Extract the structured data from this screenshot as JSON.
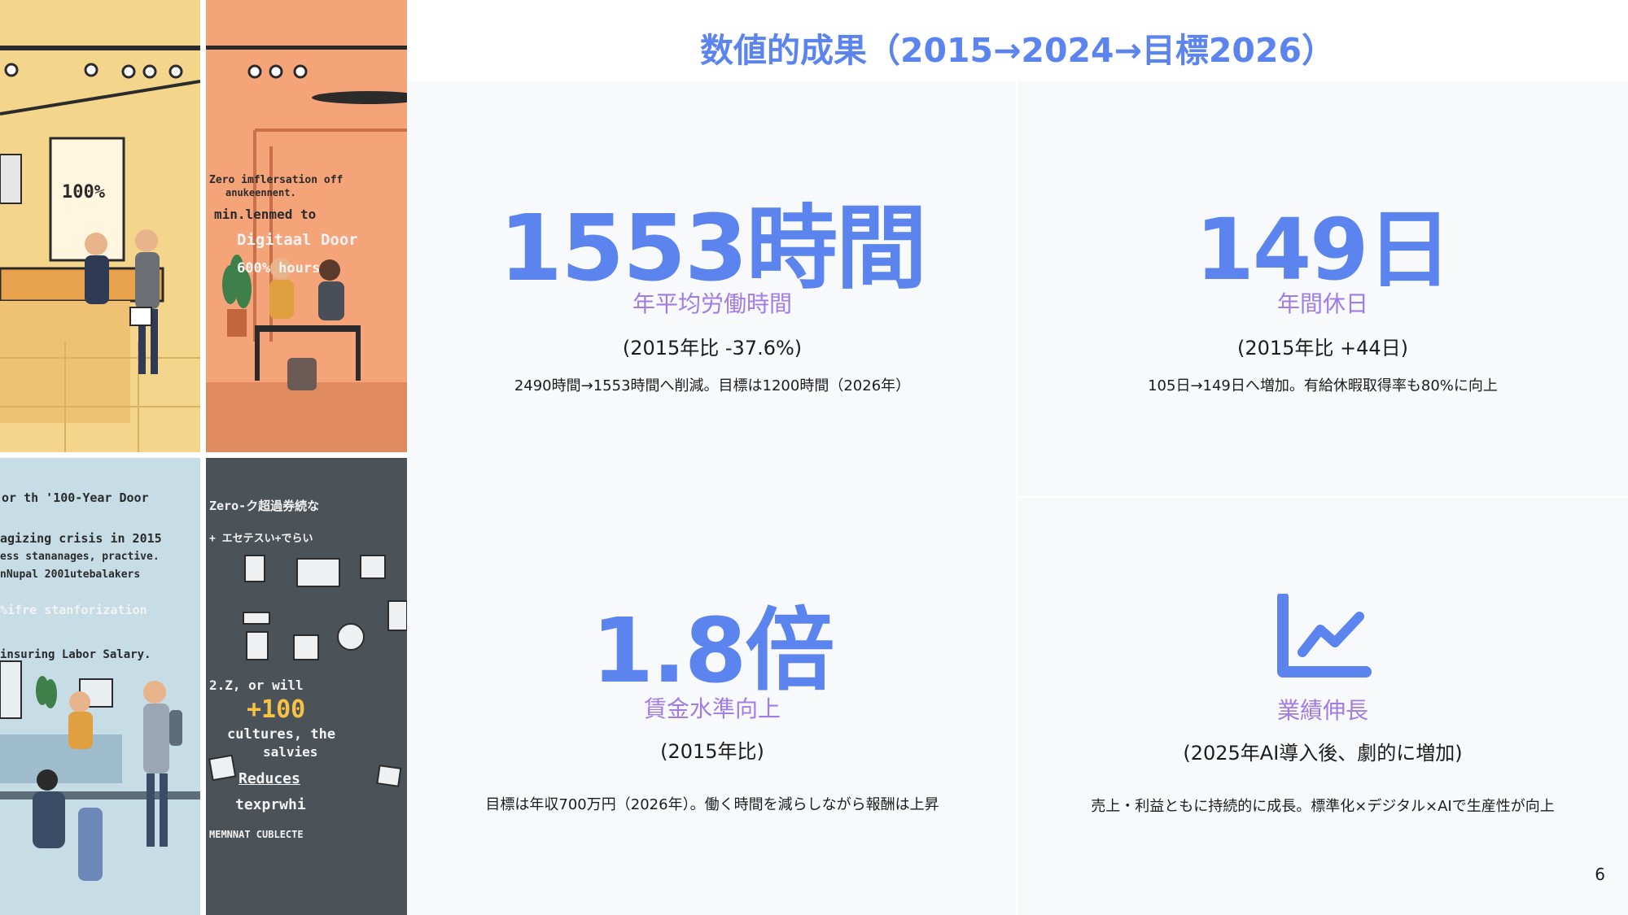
{
  "title": "数値的成果（2015→2024→目標2026）",
  "metrics": [
    {
      "value": "1553時間",
      "label": "年平均労働時間",
      "sub": "(2015年比 -37.6%)",
      "desc": "2490時間→1553時間へ削減。目標は1200時間（2026年）"
    },
    {
      "value": "149日",
      "label": "年間休日",
      "sub": "(2015年比 +44日)",
      "desc": "105日→149日へ増加。有給休暇取得率も80%に向上"
    },
    {
      "value": "1.8倍",
      "label": "賃金水準向上",
      "sub": "(2015年比)",
      "desc": "目標は年収700万円（2026年）。働く時間を減らしながら報酬は上昇"
    },
    {
      "icon": "line-chart-icon",
      "label": "業績伸長",
      "sub": "(2025年AI導入後、劇的に増加)",
      "desc": "売上・利益ともに持続的に成長。標準化×デジタル×AIで生産性が向上"
    }
  ],
  "page_number": "6",
  "collage": {
    "panel1": {
      "sign": "100%"
    },
    "panel2": {
      "lines": [
        "Zero imflersation off",
        "anukeennent.",
        "min.lenmed to",
        "Digitaal Door",
        "600% hours"
      ]
    },
    "panel3": {
      "lines": [
        "or th '100-Year Door",
        "agizing crisis in 2015",
        "ess stananages, practive.",
        "nNupal 2001utebalakers",
        "%ifre stanforization",
        "insuring Labor Salary."
      ]
    },
    "panel4": {
      "lines": [
        "Zero-ク超過券続な",
        "+ エセテスい+でらい",
        "2.Z, or will",
        "+100",
        "cultures, the",
        "salvies",
        "Reduces",
        "texprwhi",
        "MEMNNAT CUBLECTE"
      ]
    }
  },
  "colors": {
    "accent": "#5b84ee",
    "label": "#a07ce6",
    "card": "#f8f9fa"
  }
}
